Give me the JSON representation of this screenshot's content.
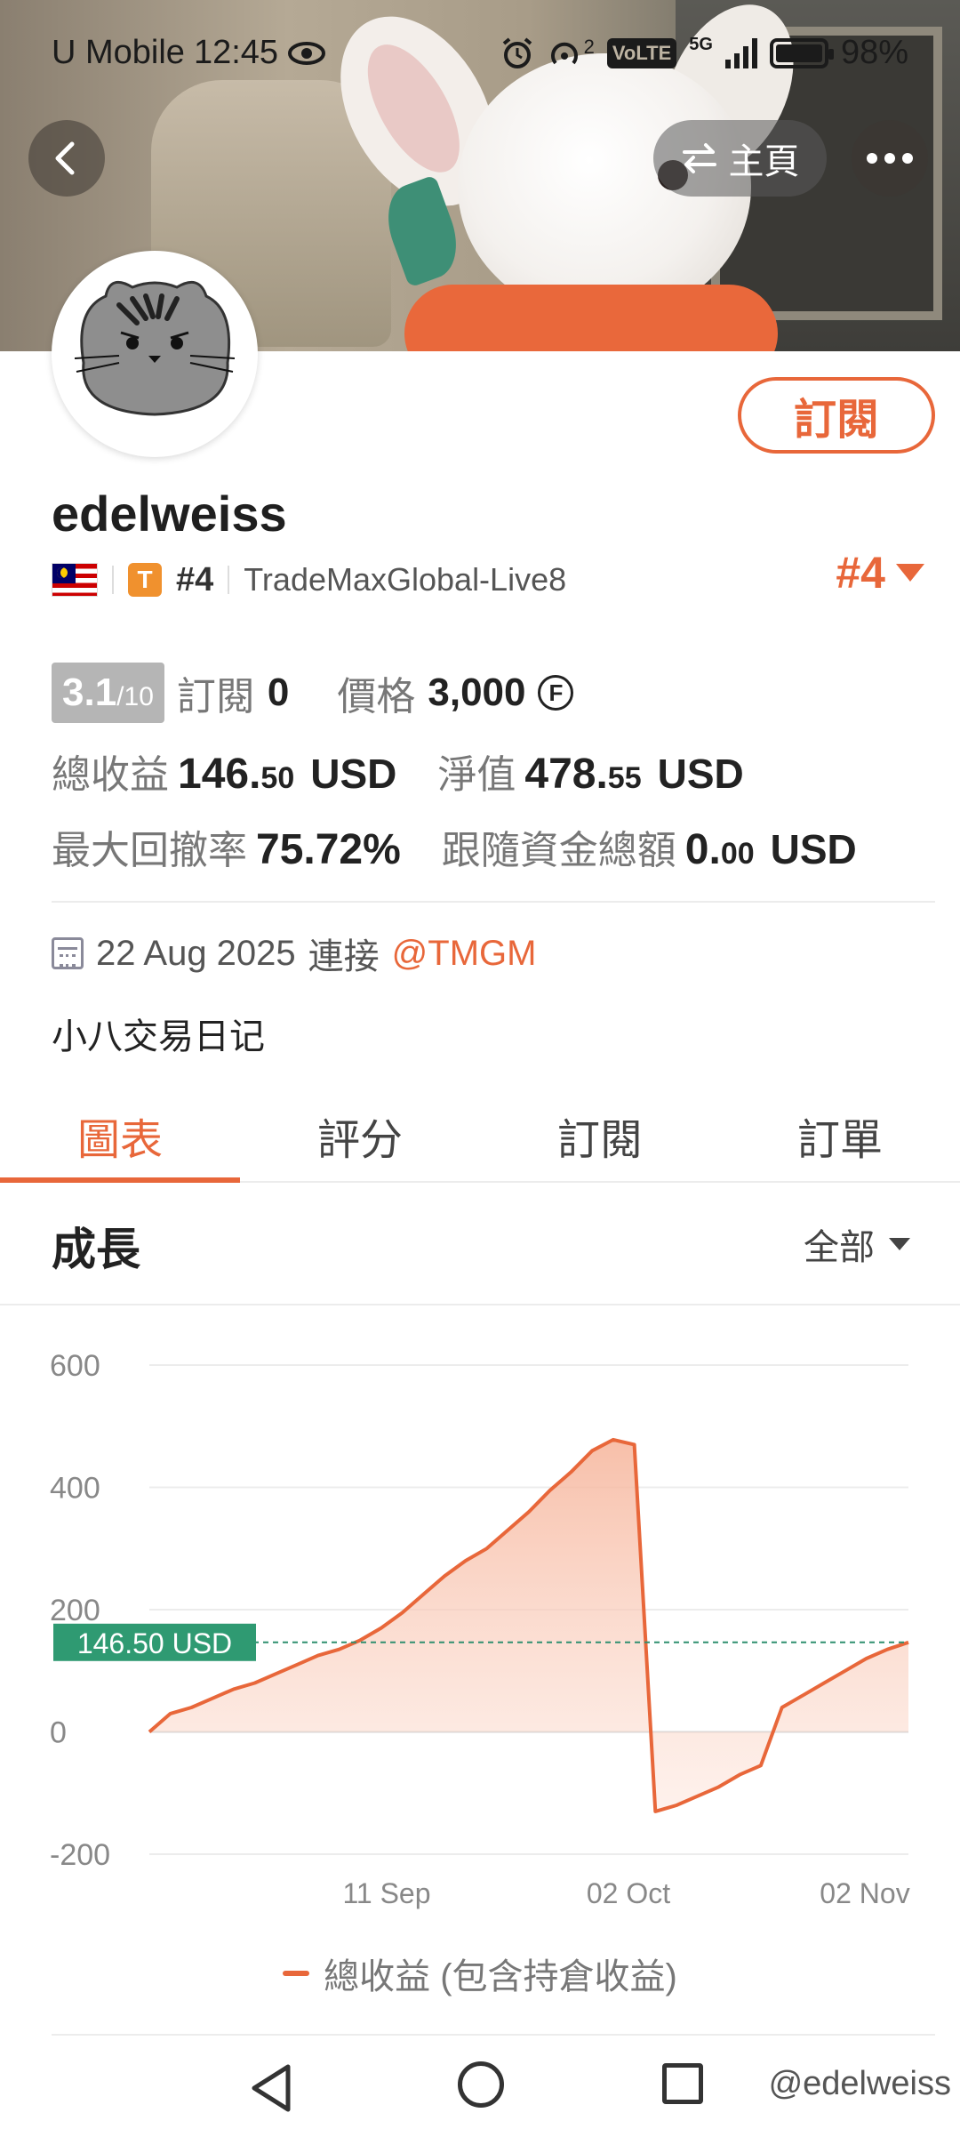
{
  "status_bar": {
    "carrier": "U Mobile",
    "time": "12:45",
    "volte": "VoLTE",
    "network": "5G",
    "signal_sup": "2",
    "battery": "98%"
  },
  "header": {
    "home_label": "主頁"
  },
  "profile": {
    "username": "edelweiss",
    "rank_small": "#4",
    "server": "TradeMaxGlobal-Live8",
    "rank_big": "#4",
    "subscribe_label": "訂閱"
  },
  "stats": {
    "score": "3.1",
    "score_max": "/10",
    "subscribers_label": "訂閱",
    "subscribers": "0",
    "price_label": "價格",
    "price": "3,000",
    "coin_symbol": "F",
    "total_profit_label": "總收益",
    "total_profit_int": "146.",
    "total_profit_dec": "50",
    "total_profit_unit": "USD",
    "equity_label": "淨值",
    "equity_int": "478.",
    "equity_dec": "55",
    "equity_unit": "USD",
    "drawdown_label": "最大回撤率",
    "drawdown": "75.72%",
    "follow_funds_label": "跟隨資金總額",
    "follow_funds_int": "0.",
    "follow_funds_dec": "00",
    "follow_funds_unit": "USD"
  },
  "connection": {
    "date": "22 Aug 2025",
    "connect_label": "連接",
    "broker": "@TMGM"
  },
  "bio": "小八交易日记",
  "tabs": [
    {
      "label": "圖表",
      "active": true
    },
    {
      "label": "評分",
      "active": false
    },
    {
      "label": "訂閱",
      "active": false
    },
    {
      "label": "訂單",
      "active": false
    }
  ],
  "section": {
    "title": "成長",
    "filter": "全部"
  },
  "chart_data": {
    "type": "area",
    "y_ticks": [
      "600",
      "400",
      "200",
      "0",
      "-200"
    ],
    "ylim": [
      -200,
      600
    ],
    "x_tick_labels": [
      "11 Sep",
      "02 Oct",
      "02 Nov"
    ],
    "current_value_label": "146.50 USD",
    "current_value": 146.5,
    "series": [
      {
        "name": "總收益 (包含持倉收益)",
        "color": "#e8673a",
        "values": [
          0,
          30,
          40,
          55,
          70,
          80,
          95,
          110,
          125,
          135,
          150,
          170,
          195,
          225,
          255,
          280,
          300,
          330,
          360,
          395,
          425,
          460,
          478,
          470,
          -130,
          -120,
          -105,
          -90,
          -70,
          -55,
          40,
          60,
          80,
          100,
          120,
          135,
          146.5
        ]
      }
    ],
    "legend": "總收益 (包含持倉收益)",
    "grid": true
  },
  "watermark": "@edelweiss"
}
